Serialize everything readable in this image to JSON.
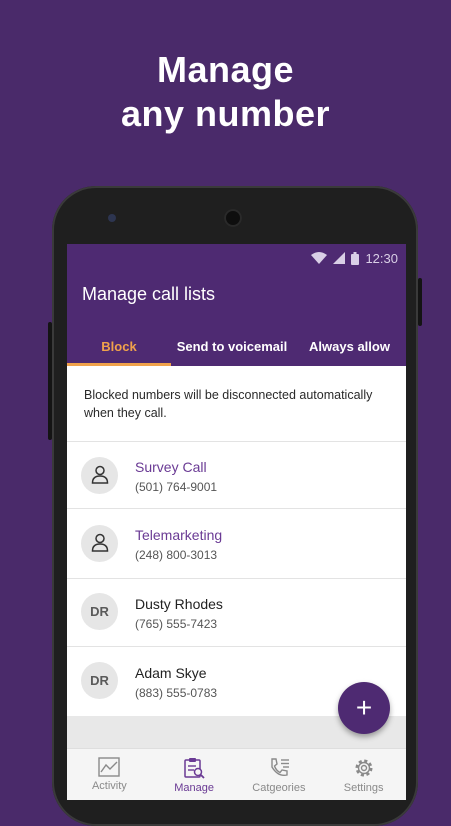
{
  "promo": {
    "line1": "Manage",
    "line2": "any number"
  },
  "status": {
    "time": "12:30",
    "icons": [
      "wifi-icon",
      "cell-signal-icon",
      "battery-icon"
    ]
  },
  "app": {
    "title": "Manage call lists",
    "tabs": [
      {
        "label": "Block",
        "active": true
      },
      {
        "label": "Send to voicemail",
        "active": false
      },
      {
        "label": "Always allow",
        "active": false
      }
    ],
    "description": "Blocked numbers will be disconnected automatically when they call.",
    "entries": [
      {
        "avatar": "",
        "name": "Survey Call",
        "number": "(501) 764-9001"
      },
      {
        "avatar": "",
        "name": "Telemarketing",
        "number": "(248) 800-3013"
      },
      {
        "avatar": "DR",
        "name": "Dusty Rhodes",
        "number": "(765) 555-7423"
      },
      {
        "avatar": "DR",
        "name": "Adam Skye",
        "number": "(883) 555-0783"
      }
    ],
    "fab": "+"
  },
  "nav": [
    {
      "label": "Activity",
      "icon": "activity-icon",
      "active": false
    },
    {
      "label": "Manage",
      "icon": "manage-icon",
      "active": true
    },
    {
      "label": "Catgeories",
      "icon": "categories-icon",
      "active": false
    },
    {
      "label": "Settings",
      "icon": "settings-icon",
      "active": false
    }
  ],
  "colors": {
    "background": "#4a2a6a",
    "appbar": "#4e2a72",
    "accent": "#f0a24b",
    "active_nav": "#6a3a94"
  }
}
